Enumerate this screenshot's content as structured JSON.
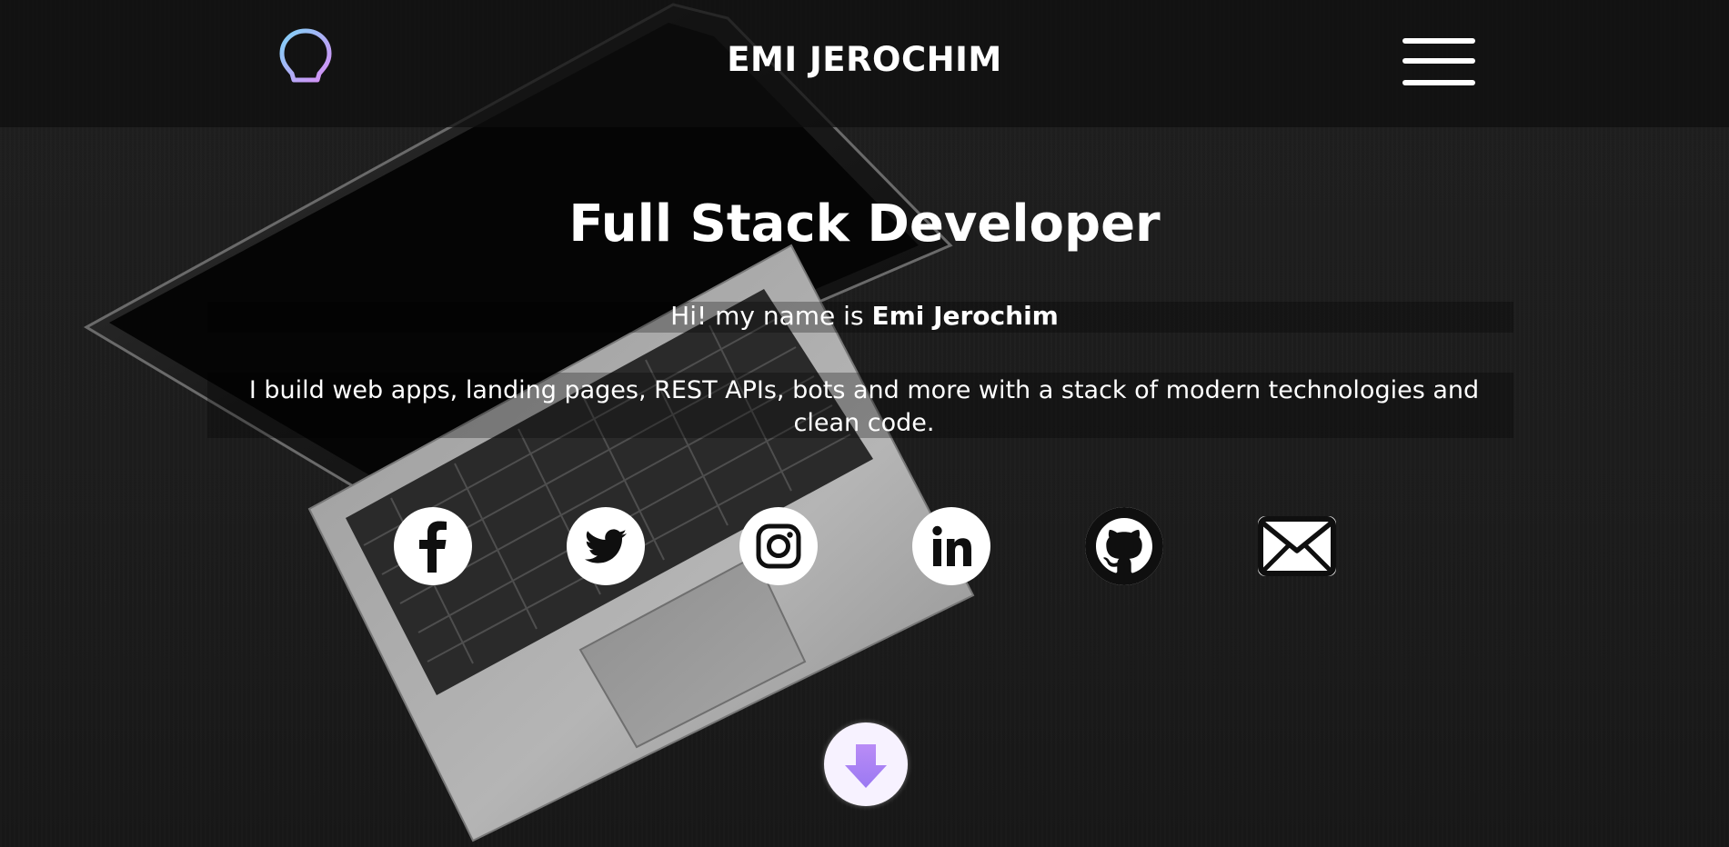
{
  "header": {
    "brand": "EMI JEROCHIM",
    "logo_icon": "lightbulb-icon",
    "menu_icon": "hamburger-menu-icon"
  },
  "hero": {
    "title": "Full Stack Developer",
    "intro_prefix": "Hi! my name is ",
    "intro_name": "Emi Jerochim",
    "description": "I build web apps, landing pages, REST APIs, bots and more with a stack of modern technologies and clean code."
  },
  "social": [
    {
      "icon": "facebook-icon"
    },
    {
      "icon": "twitter-icon"
    },
    {
      "icon": "instagram-icon"
    },
    {
      "icon": "linkedin-icon"
    },
    {
      "icon": "github-icon"
    },
    {
      "icon": "email-icon"
    }
  ],
  "scroll": {
    "icon": "arrow-down-icon"
  },
  "colors": {
    "logo_gradient_start": "#7fd3f7",
    "logo_gradient_end": "#d98cf5",
    "accent_purple": "#b88cf5",
    "text": "#ffffff"
  }
}
